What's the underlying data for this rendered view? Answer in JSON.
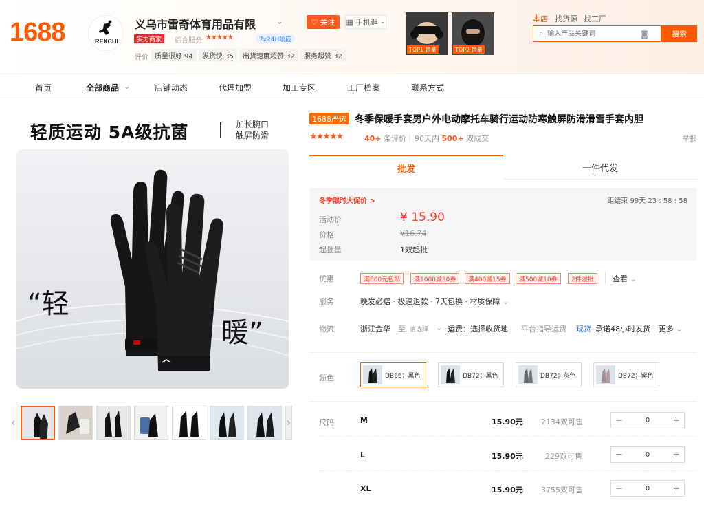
{
  "header": {
    "logo": "1688",
    "shop_logo_text": "REXCHI",
    "shop_name": "义乌市雷奇体育用品有限",
    "follow_label": "关注",
    "mobile_label": "手机逛",
    "power_badge": "实力商家",
    "overall_label": "综合服务",
    "overall_stars": "★★★★★",
    "response_badge": "7x24H响应",
    "rating_label": "评价",
    "ratings": [
      "质量很好 94",
      "发货快 35",
      "出货速度超赞 32",
      "服务超赞 32"
    ],
    "top_products": [
      {
        "label": "TOP1 销量"
      },
      {
        "label": "TOP2 销量"
      }
    ],
    "search_tabs": [
      "本店",
      "找货源",
      "找工厂"
    ],
    "search_placeholder": "输入产品关键词",
    "search_button": "搜索"
  },
  "nav": {
    "items": [
      "首页",
      "全部商品",
      "店铺动态",
      "代理加盟",
      "加工专区",
      "工厂档案",
      "联系方式"
    ]
  },
  "gallery": {
    "slogan": "轻质运动 5A级抗菌",
    "slogan_sub1": "加长腕口",
    "slogan_sub2": "触屏防滑",
    "quote1": "“轻",
    "quote2": "暖”",
    "thumb_count": 8
  },
  "product": {
    "badge": "1688严选",
    "title": "冬季保暖手套男户外电动摩托车骑行运动防寒触屏防滑滑雪手套内胆",
    "stars": "★★★★★",
    "review_count": "40+",
    "review_suffix": "条评价",
    "sales_prefix": "90天内",
    "sales_count": "500+",
    "sales_suffix": "双成交",
    "report": "举报",
    "tabs": {
      "wholesale": "批发",
      "dropship": "一件代发"
    },
    "promo_title": "冬季限时大促价 >",
    "countdown_label": "距结束",
    "countdown": "99天 23 : 58 : 58",
    "activity_label": "活动价",
    "activity_price": "¥ 15.90",
    "price_label": "价格",
    "original_price": "¥16.74",
    "moq_label": "起批量",
    "moq": "1双起批",
    "discount_label": "优惠",
    "coupons": [
      "满800元包邮",
      "满1000减30券",
      "满400减15券",
      "满500减10券",
      "2件混批"
    ],
    "coupon_more": "查看",
    "service_label": "服务",
    "service": "晚发必赔 · 极速退款 · 7天包换 · 材质保障",
    "logistics_label": "物流",
    "logistics_from": "浙江金华",
    "logistics_to": "至",
    "logistics_select": "请选择",
    "logistics_fee": "运费：选择收货地",
    "logistics_platform": "平台指导运费",
    "logistics_stock": "现货",
    "logistics_promise": "承诺48小时发货",
    "logistics_more": "更多",
    "color_label": "颜色",
    "colors": [
      "DB66；黑色",
      "DB72；黑色",
      "DB72；灰色",
      "DB72；紫色"
    ],
    "size_label": "尺码",
    "sizes": [
      {
        "name": "M",
        "price": "15.90元",
        "stock": "2134双可售",
        "qty": "0"
      },
      {
        "name": "L",
        "price": "15.90元",
        "stock": "229双可售",
        "qty": "0"
      },
      {
        "name": "XL",
        "price": "15.90元",
        "stock": "3755双可售",
        "qty": "0"
      }
    ]
  },
  "colors": {
    "accent": "#ff5a00",
    "price": "#ff3a22"
  }
}
